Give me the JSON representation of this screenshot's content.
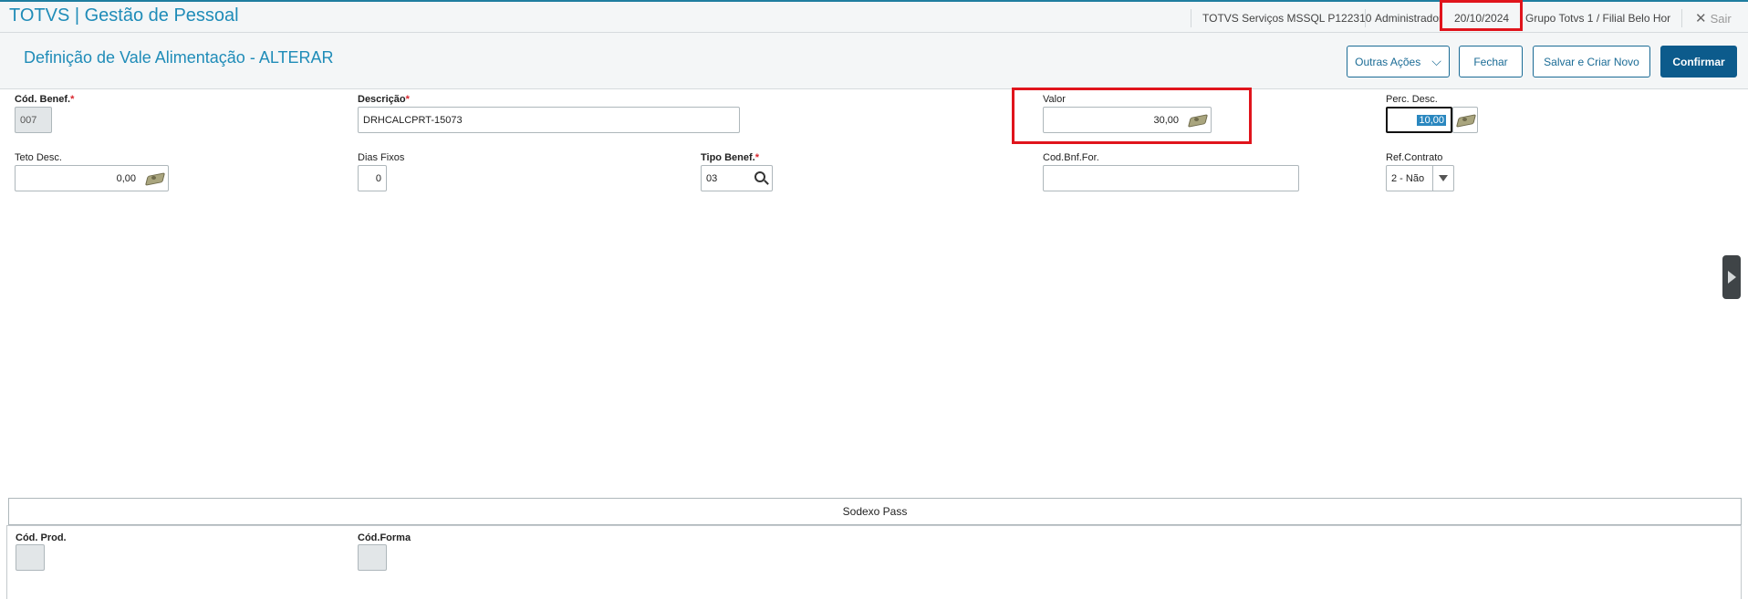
{
  "app": {
    "title": "TOTVS | Gestão de Pessoal"
  },
  "topbar": {
    "environment": "TOTVS Serviços MSSQL P122310",
    "user": "Administrador",
    "date": "20/10/2024",
    "branch": "Grupo Totvs 1 / Filial Belo Hor",
    "exit_label": "Sair"
  },
  "header": {
    "title": "Definição de Vale Alimentação - ALTERAR",
    "buttons": {
      "other_actions": "Outras Ações",
      "close": "Fechar",
      "save_new": "Salvar e Criar Novo",
      "confirm": "Confirmar"
    }
  },
  "form": {
    "cod_benef": {
      "label": "Cód. Benef.",
      "value": "007"
    },
    "descricao": {
      "label": "Descrição",
      "value": "DRHCALCPRT-15073"
    },
    "valor": {
      "label": "Valor",
      "value": "30,00"
    },
    "perc_desc": {
      "label": "Perc. Desc.",
      "value": "10,00"
    },
    "teto_desc": {
      "label": "Teto Desc.",
      "value": "0,00"
    },
    "dias_fixos": {
      "label": "Dias Fixos",
      "value": "0"
    },
    "tipo_benef": {
      "label": "Tipo Benef.",
      "value": "03"
    },
    "cod_bnf_for": {
      "label": "Cod.Bnf.For.",
      "value": ""
    },
    "ref_contrato": {
      "label": "Ref.Contrato",
      "value": "2 - Não"
    }
  },
  "sodexo": {
    "title": "Sodexo Pass",
    "cod_prod": {
      "label": "Cód. Prod.",
      "value": ""
    },
    "cod_forma": {
      "label": "Cód.Forma",
      "value": ""
    }
  },
  "required_mark": "*",
  "colors": {
    "brand": "#1f8cb8",
    "primary_button": "#0c5b8c",
    "highlight": "#e0141c"
  }
}
